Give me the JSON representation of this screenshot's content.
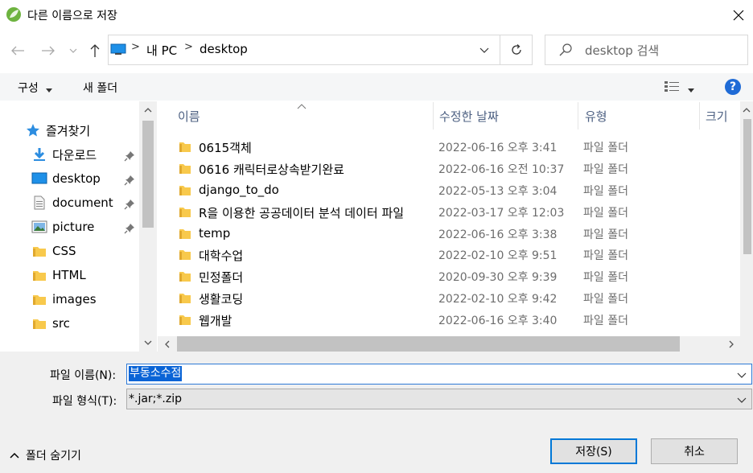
{
  "window": {
    "title": "다른 이름으로 저장",
    "app_icon": "leaf-icon",
    "close_icon": "close-icon"
  },
  "nav": {
    "back_icon": "arrow-left-icon",
    "forward_icon": "arrow-right-icon",
    "recent_icon": "chevron-down-icon",
    "up_icon": "arrow-up-icon",
    "refresh_icon": "refresh-icon"
  },
  "address": {
    "crumbs": [
      "내 PC",
      "desktop"
    ],
    "separator": ">"
  },
  "search": {
    "placeholder": "desktop 검색"
  },
  "toolbar": {
    "organize_label": "구성",
    "new_folder_label": "새 폴더",
    "help_label": "?"
  },
  "sidebar": {
    "items": [
      {
        "label": "즐겨찾기",
        "icon": "star-icon",
        "pinned": false
      },
      {
        "label": "다운로드",
        "icon": "download-icon",
        "pinned": true
      },
      {
        "label": "desktop",
        "icon": "desktop-icon",
        "pinned": true
      },
      {
        "label": "document",
        "icon": "document-icon",
        "pinned": true
      },
      {
        "label": "picture",
        "icon": "picture-icon",
        "pinned": true
      },
      {
        "label": "CSS",
        "icon": "folder-icon",
        "pinned": false
      },
      {
        "label": "HTML",
        "icon": "folder-icon",
        "pinned": false
      },
      {
        "label": "images",
        "icon": "folder-icon",
        "pinned": false
      },
      {
        "label": "src",
        "icon": "folder-icon",
        "pinned": false
      }
    ]
  },
  "files": {
    "columns": [
      "이름",
      "수정한 날짜",
      "유형",
      "크기"
    ],
    "rows": [
      {
        "name": "0615객체",
        "date": "2022-06-16 오후 3:41",
        "type": "파일 폴더"
      },
      {
        "name": "0616 캐릭터로상속받기완료",
        "date": "2022-06-16 오전 10:37",
        "type": "파일 폴더"
      },
      {
        "name": "django_to_do",
        "date": "2022-05-13 오후 3:04",
        "type": "파일 폴더"
      },
      {
        "name": "R을 이용한 공공데이터 분석 데이터 파일",
        "date": "2022-03-17 오후 12:03",
        "type": "파일 폴더"
      },
      {
        "name": "temp",
        "date": "2022-06-16 오후 3:38",
        "type": "파일 폴더"
      },
      {
        "name": "대학수업",
        "date": "2022-02-10 오후 9:51",
        "type": "파일 폴더"
      },
      {
        "name": "민정폴더",
        "date": "2020-09-30 오후 9:39",
        "type": "파일 폴더"
      },
      {
        "name": "생활코딩",
        "date": "2022-02-10 오후 9:42",
        "type": "파일 폴더"
      },
      {
        "name": "웹개발",
        "date": "2022-06-16 오후 3:40",
        "type": "파일 폴더"
      }
    ]
  },
  "form": {
    "filename_label": "파일 이름(N):",
    "filename_value": "부동소수점",
    "filetype_label": "파일 형식(T):",
    "filetype_value": "*.jar;*.zip"
  },
  "footer": {
    "hide_folders_label": "폴더 숨기기",
    "save_label": "저장(S)",
    "cancel_label": "취소"
  },
  "colors": {
    "accent": "#0078d7",
    "selection": "#0a64d6",
    "folder": "#f8c94c",
    "header_text": "#4d6082"
  }
}
